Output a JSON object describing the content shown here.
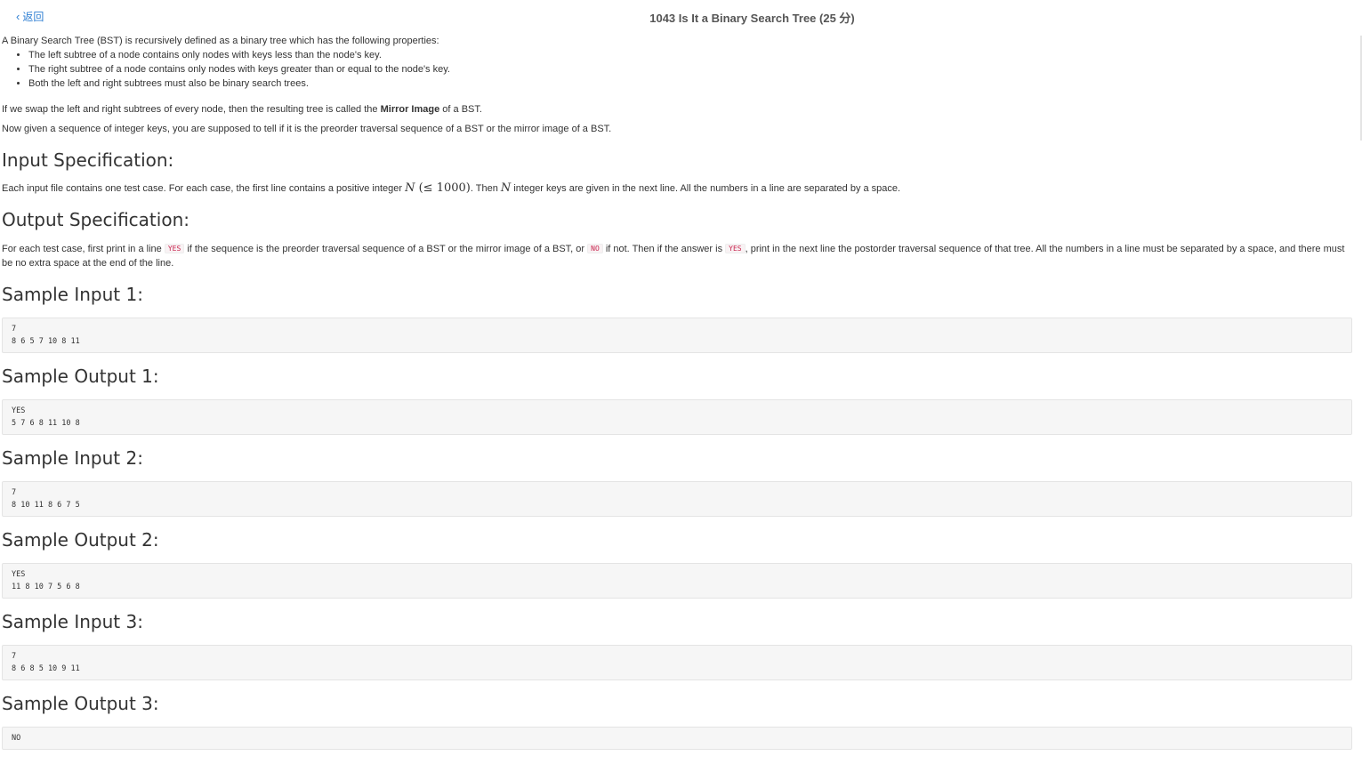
{
  "header": {
    "back_label": "返回",
    "title": "1043 Is It a Binary Search Tree (25 分)"
  },
  "description": {
    "intro": "A Binary Search Tree (BST) is recursively defined as a binary tree which has the following properties:",
    "rules": [
      "The left subtree of a node contains only nodes with keys less than the node's key.",
      "The right subtree of a node contains only nodes with keys greater than or equal to the node's key.",
      "Both the left and right subtrees must also be binary search trees."
    ],
    "mirror_before": "If we swap the left and right subtrees of every node, then the resulting tree is called the ",
    "mirror_bold": "Mirror Image",
    "mirror_after": " of a BST.",
    "given": "Now given a sequence of integer keys, you are supposed to tell if it is the preorder traversal sequence of a BST or the mirror image of a BST."
  },
  "input_spec": {
    "heading": "Input Specification:",
    "part1": "Each input file contains one test case. For each case, the first line contains a positive integer ",
    "math1_var": "N",
    "math1_rest": " (≤ 1000)",
    "part2": ". Then ",
    "math2_var": "N",
    "part3": " integer keys are given in the next line. All the numbers in a line are separated by a space."
  },
  "output_spec": {
    "heading": "Output Specification:",
    "part1": "For each test case, first print in a line ",
    "code_yes": "YES",
    "part2": " if the sequence is the preorder traversal sequence of a BST or the mirror image of a BST, or ",
    "code_no": "NO",
    "part3": " if not. Then if the answer is ",
    "code_yes2": "YES",
    "part4": ", print in the next line the postorder traversal sequence of that tree. All the numbers in a line must be separated by a space, and there must be no extra space at the end of the line."
  },
  "samples": [
    {
      "heading": "Sample Input 1:",
      "content": "7\n8 6 5 7 10 8 11"
    },
    {
      "heading": "Sample Output 1:",
      "content": "YES\n5 7 6 8 11 10 8"
    },
    {
      "heading": "Sample Input 2:",
      "content": "7\n8 10 11 8 6 7 5"
    },
    {
      "heading": "Sample Output 2:",
      "content": "YES\n11 8 10 7 5 6 8"
    },
    {
      "heading": "Sample Input 3:",
      "content": "7\n8 6 8 5 10 9 11"
    },
    {
      "heading": "Sample Output 3:",
      "content": "NO"
    }
  ],
  "colors": {
    "link": "#2f7fd3",
    "code_bg": "#f6f6f6",
    "inline_code": "#c7254e"
  }
}
